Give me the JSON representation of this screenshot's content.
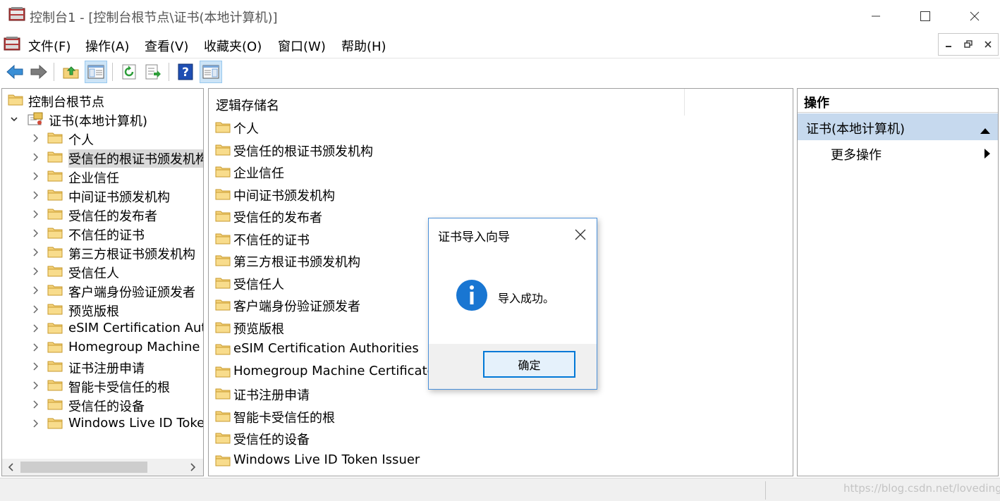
{
  "window": {
    "title": "控制台1 - [控制台根节点\\证书(本地计算机)]",
    "minimize_icon": "minimize-icon",
    "maximize_icon": "maximize-icon",
    "close_icon": "close-icon"
  },
  "menu": {
    "items": [
      "文件(F)",
      "操作(A)",
      "查看(V)",
      "收藏夹(O)",
      "窗口(W)",
      "帮助(H)"
    ]
  },
  "toolbar": {
    "buttons": [
      "back-icon",
      "forward-icon",
      "up-folder-icon",
      "show-hide-tree-icon",
      "refresh-icon",
      "export-list-icon",
      "help-icon",
      "show-hide-action-pane-icon"
    ]
  },
  "tree": {
    "root": "控制台根节点",
    "certs_node": "证书(本地计算机)",
    "children": [
      "个人",
      "受信任的根证书颁发机构",
      "企业信任",
      "中间证书颁发机构",
      "受信任的发布者",
      "不信任的证书",
      "第三方根证书颁发机构",
      "受信任人",
      "客户端身份验证颁发者",
      "预览版根",
      "eSIM Certification Authorities",
      "Homegroup Machine Certificates",
      "证书注册申请",
      "智能卡受信任的根",
      "受信任的设备",
      "Windows Live ID Token Issuer"
    ],
    "selected_index": 1
  },
  "list": {
    "column_header": "逻辑存储名",
    "items": [
      "个人",
      "受信任的根证书颁发机构",
      "企业信任",
      "中间证书颁发机构",
      "受信任的发布者",
      "不信任的证书",
      "第三方根证书颁发机构",
      "受信任人",
      "客户端身份验证颁发者",
      "预览版根",
      "eSIM Certification Authorities",
      "Homegroup Machine Certificates",
      "证书注册申请",
      "智能卡受信任的根",
      "受信任的设备",
      "Windows Live ID Token Issuer"
    ]
  },
  "actions": {
    "header": "操作",
    "group": "证书(本地计算机)",
    "more": "更多操作"
  },
  "dialog": {
    "title": "证书导入向导",
    "message": "导入成功。",
    "ok_label": "确定",
    "icon": "info-icon"
  },
  "status": {
    "watermark": "https://blog.csdn.net/lovedingd"
  },
  "colors": {
    "accent": "#0078d7",
    "selection": "#d9d9d9",
    "action_group_bg": "#c6d9ee",
    "folder": "#f4d27a"
  }
}
